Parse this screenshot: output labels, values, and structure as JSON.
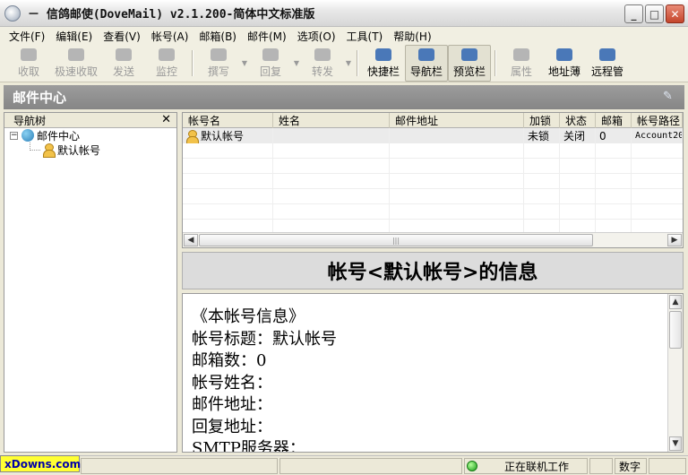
{
  "window": {
    "title": "－ 信鸽邮使(DoveMail) v2.1.200-简体中文标准版",
    "minimize": "_",
    "maximize": "□",
    "close": "✕"
  },
  "menu": [
    "文件(F)",
    "编辑(E)",
    "查看(V)",
    "帐号(A)",
    "邮箱(B)",
    "邮件(M)",
    "选项(O)",
    "工具(T)",
    "帮助(H)"
  ],
  "toolbar": {
    "receive": "收取",
    "quick_receive": "极速收取",
    "send": "发送",
    "monitor": "监控",
    "compose": "撰写",
    "reply": "回复",
    "forward": "转发",
    "shortcut_bar": "快捷栏",
    "nav_bar": "导航栏",
    "preview_bar": "预览栏",
    "properties": "属性",
    "address_book": "地址薄",
    "remote": "远程管"
  },
  "mail_center_title": "邮件中心",
  "nav": {
    "header": "导航树",
    "close": "✕",
    "expander": "−",
    "root": "邮件中心",
    "child": "默认帐号"
  },
  "list": {
    "columns": [
      "帐号名",
      "姓名",
      "邮件地址",
      "加锁",
      "状态",
      "邮箱",
      "帐号路径"
    ],
    "rows": [
      {
        "name": "默认帐号",
        "real_name": "",
        "email": "",
        "lock": "未锁",
        "status": "关闭",
        "mailbox": "0",
        "path": "Account20"
      }
    ],
    "scroll_grip": "|||"
  },
  "info": {
    "title": "帐号<默认帐号>的信息",
    "lines": [
      "《本帐号信息》",
      "帐号标题：默认帐号",
      "邮箱数：0",
      "帐号姓名：",
      "邮件地址：",
      "回复地址：",
      "SMTP服务器："
    ]
  },
  "status": {
    "watermark": "xDowns.com",
    "online": "正在联机工作",
    "numlock": "数字"
  }
}
